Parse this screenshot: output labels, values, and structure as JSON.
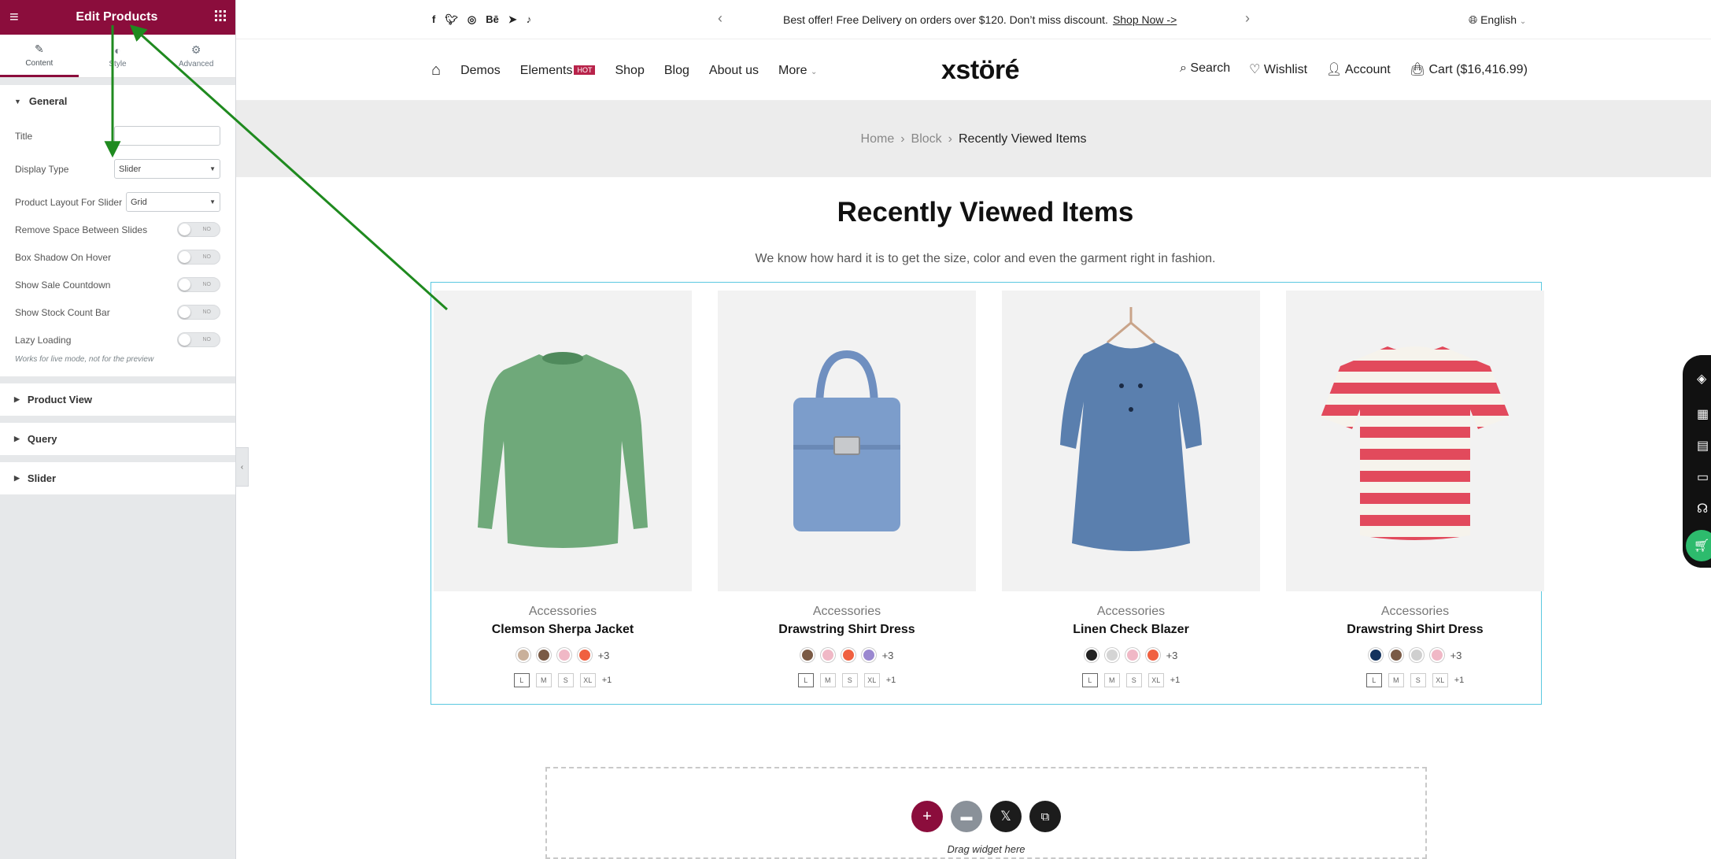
{
  "editor": {
    "title": "Edit Products",
    "tabs": [
      {
        "label": "Content"
      },
      {
        "label": "Style"
      },
      {
        "label": "Advanced"
      }
    ],
    "general": {
      "heading": "General",
      "title_label": "Title",
      "title_value": "",
      "display_type_label": "Display Type",
      "display_type_value": "Slider",
      "layout_label": "Product Layout For Slider",
      "layout_value": "Grid",
      "toggles": [
        {
          "label": "Remove Space Between Slides",
          "state": "NO"
        },
        {
          "label": "Box Shadow On Hover",
          "state": "NO"
        },
        {
          "label": "Show Sale Countdown",
          "state": "NO"
        },
        {
          "label": "Show Stock Count Bar",
          "state": "NO"
        },
        {
          "label": "Lazy Loading",
          "state": "NO"
        }
      ],
      "note": "Works for live mode, not for the preview"
    },
    "sections": [
      "Product View",
      "Query",
      "Slider"
    ]
  },
  "topbar": {
    "promo": "Best offer! Free Delivery on orders over $120. Don’t miss discount.",
    "promo_link": "Shop Now ->",
    "language": "English"
  },
  "header": {
    "nav": [
      "Demos",
      "Elements",
      "Shop",
      "Blog",
      "About us",
      "More"
    ],
    "hot_badge": "HOT",
    "logo": "xstöré",
    "search": "Search",
    "wishlist": "Wishlist",
    "account": "Account",
    "cart": "Cart ($16,416.99)"
  },
  "breadcrumb": {
    "home": "Home",
    "block": "Block",
    "current": "Recently Viewed Items"
  },
  "page": {
    "title": "Recently Viewed Items",
    "subtitle": "We know how hard it is to get the size, color and even the garment right in fashion."
  },
  "products": [
    {
      "category": "Accessories",
      "name": "Clemson Sherpa Jacket",
      "swatches": [
        "#c9b09a",
        "#7a5a45",
        "#f0b8c6",
        "#f06040"
      ],
      "more_colors": "+3",
      "sizes": [
        "L",
        "M",
        "S",
        "XL"
      ],
      "more_sizes": "+1",
      "image": "green-sweater"
    },
    {
      "category": "Accessories",
      "name": "Drawstring Shirt Dress",
      "swatches": [
        "#7a5a45",
        "#f0b8c6",
        "#f06040",
        "#9a88d0"
      ],
      "more_colors": "+3",
      "sizes": [
        "L",
        "M",
        "S",
        "XL"
      ],
      "more_sizes": "+1",
      "image": "blue-handbag"
    },
    {
      "category": "Accessories",
      "name": "Linen Check Blazer",
      "swatches": [
        "#222222",
        "#d4d4d4",
        "#f0b8c6",
        "#f06040"
      ],
      "more_colors": "+3",
      "sizes": [
        "L",
        "M",
        "S",
        "XL"
      ],
      "more_sizes": "+1",
      "image": "blue-dress"
    },
    {
      "category": "Accessories",
      "name": "Drawstring Shirt Dress",
      "swatches": [
        "#14335e",
        "#7a5a45",
        "#cfcfcf",
        "#f0b8c6"
      ],
      "more_colors": "+3",
      "sizes": [
        "L",
        "M",
        "S",
        "XL"
      ],
      "more_sizes": "+1",
      "image": "striped-tshirt"
    }
  ],
  "dropzone": {
    "text": "Drag widget here"
  },
  "colors": {
    "brand": "#8b0d3c",
    "annotation_arrow": "#1f8a1f",
    "highlight": "#5ac8e0"
  }
}
